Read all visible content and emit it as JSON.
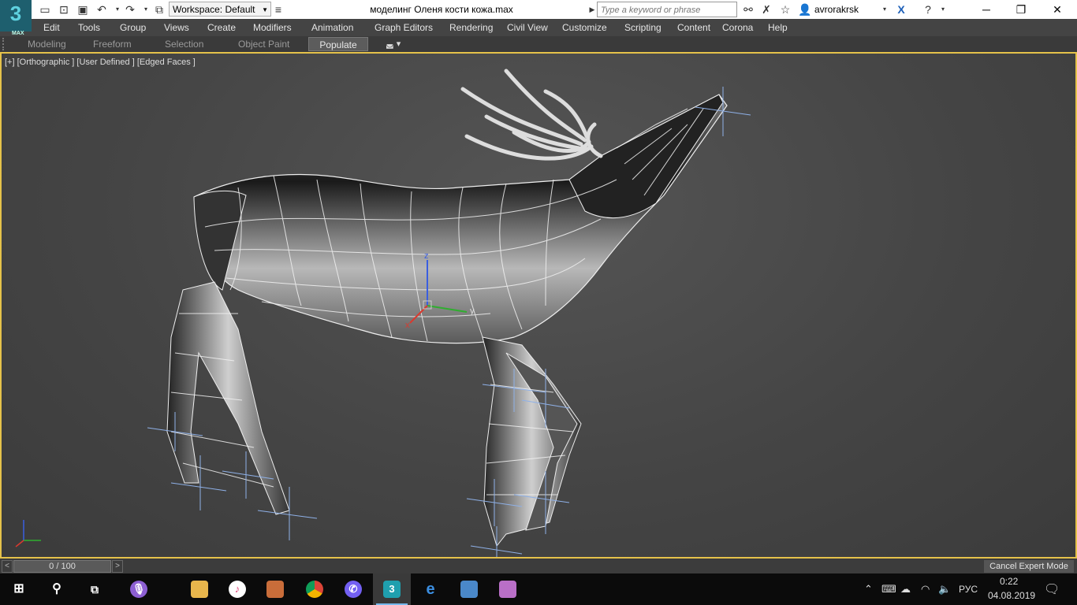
{
  "titlebar": {
    "logo_text": "3",
    "logo_sub": "MAX",
    "workspace": "Workspace: Default",
    "doc_title": "моделинг Оленя кости кожа.max",
    "search_placeholder": "Type a keyword or phrase",
    "user_name": "avrorakrsk"
  },
  "menu": [
    "Edit",
    "Tools",
    "Group",
    "Views",
    "Create",
    "Modifiers",
    "Animation",
    "Graph Editors",
    "Rendering",
    "Civil View",
    "Customize",
    "Scripting",
    "Content",
    "Corona",
    "Help"
  ],
  "ribbon": {
    "tabs": [
      "Modeling",
      "Freeform",
      "Selection",
      "Object Paint"
    ],
    "active_tab": "Populate"
  },
  "viewport": {
    "label": "[+] [Orthographic ] [User Defined ] [Edged Faces ]",
    "gizmo_x": "x",
    "gizmo_y": "y",
    "gizmo_z": "z"
  },
  "timeline": {
    "prev": "<",
    "frame": "0 / 100",
    "next": ">",
    "cancel_expert": "Cancel Expert Mode"
  },
  "taskbar": {
    "lang": "РУС",
    "time": "0:22",
    "date": "04.08.2019",
    "apps": [
      "Cortana voice",
      "File Explorer",
      "iTunes",
      "Paint.NET",
      "Google Chrome",
      "Viber",
      "3ds Max",
      "Microsoft Edge",
      "Photo app",
      "Paint"
    ]
  },
  "colors": {
    "viewport_border": "#e5c24a",
    "taskbar_active": "#76b9ed",
    "gizmo_x": "#d93a2f",
    "gizmo_y": "#2fae2f",
    "gizmo_z": "#3a5ee0"
  }
}
